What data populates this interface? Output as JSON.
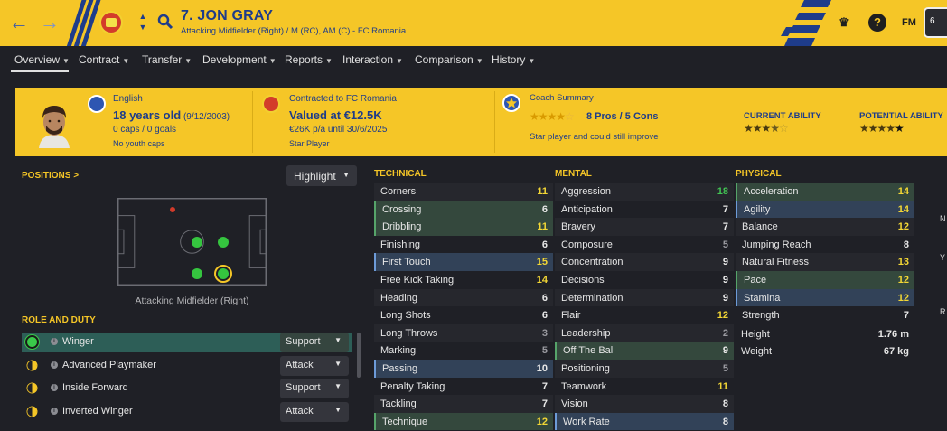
{
  "header": {
    "player_name": "7. JON GRAY",
    "player_sub": "Attacking Midfielder (Right) / M (RC), AM (C) - FC Romania",
    "fm_label": "FM",
    "help_label": "?",
    "right_box": "6"
  },
  "tabs": [
    {
      "label": "Overview"
    },
    {
      "label": "Contract"
    },
    {
      "label": "Transfer"
    },
    {
      "label": "Development"
    },
    {
      "label": "Reports"
    },
    {
      "label": "Interaction"
    },
    {
      "label": "Comparison"
    },
    {
      "label": "History"
    }
  ],
  "info": {
    "nationality": "English",
    "age": "18 years old",
    "dob": "(9/12/2003)",
    "caps": "0 caps / 0 goals",
    "youth_caps": "No youth caps",
    "contract": "Contracted to FC Romania",
    "value": "Valued at €12.5K",
    "wage": "€26K p/a until 30/6/2025",
    "status": "Star Player",
    "coach_title": "Coach Summary",
    "pros_cons": "8 Pros / 5 Cons",
    "coach_note": "Star player and could still improve",
    "coach_stars": 4.5,
    "current_ability_label": "CURRENT ABILITY",
    "current_ability_stars": 3.5,
    "potential_ability_label": "POTENTIAL ABILITY",
    "potential_ability_stars": 5
  },
  "positions": {
    "label": "POSITIONS >",
    "highlight": "Highlight",
    "pitch_caption": "Attacking Midfielder (Right)"
  },
  "roles": {
    "label": "ROLE AND DUTY",
    "items": [
      {
        "name": "Winger",
        "duty": "Support",
        "suitability": "full"
      },
      {
        "name": "Advanced Playmaker",
        "duty": "Attack",
        "suitability": "half"
      },
      {
        "name": "Inside Forward",
        "duty": "Support",
        "suitability": "half"
      },
      {
        "name": "Inverted Winger",
        "duty": "Attack",
        "suitability": "half"
      }
    ]
  },
  "technical": {
    "label": "TECHNICAL",
    "rows": [
      {
        "name": "Corners",
        "value": "11"
      },
      {
        "name": "Crossing",
        "value": "6"
      },
      {
        "name": "Dribbling",
        "value": "11"
      },
      {
        "name": "Finishing",
        "value": "6"
      },
      {
        "name": "First Touch",
        "value": "15"
      },
      {
        "name": "Free Kick Taking",
        "value": "14"
      },
      {
        "name": "Heading",
        "value": "6"
      },
      {
        "name": "Long Shots",
        "value": "6"
      },
      {
        "name": "Long Throws",
        "value": "3"
      },
      {
        "name": "Marking",
        "value": "5"
      },
      {
        "name": "Passing",
        "value": "10"
      },
      {
        "name": "Penalty Taking",
        "value": "7"
      },
      {
        "name": "Tackling",
        "value": "7"
      },
      {
        "name": "Technique",
        "value": "12"
      }
    ]
  },
  "mental": {
    "label": "MENTAL",
    "rows": [
      {
        "name": "Aggression",
        "value": "18"
      },
      {
        "name": "Anticipation",
        "value": "7"
      },
      {
        "name": "Bravery",
        "value": "7"
      },
      {
        "name": "Composure",
        "value": "5"
      },
      {
        "name": "Concentration",
        "value": "9"
      },
      {
        "name": "Decisions",
        "value": "9"
      },
      {
        "name": "Determination",
        "value": "9"
      },
      {
        "name": "Flair",
        "value": "12"
      },
      {
        "name": "Leadership",
        "value": "2"
      },
      {
        "name": "Off The Ball",
        "value": "9"
      },
      {
        "name": "Positioning",
        "value": "5"
      },
      {
        "name": "Teamwork",
        "value": "11"
      },
      {
        "name": "Vision",
        "value": "8"
      },
      {
        "name": "Work Rate",
        "value": "8"
      }
    ]
  },
  "physical": {
    "label": "PHYSICAL",
    "rows": [
      {
        "name": "Acceleration",
        "value": "14"
      },
      {
        "name": "Agility",
        "value": "14"
      },
      {
        "name": "Balance",
        "value": "12"
      },
      {
        "name": "Jumping Reach",
        "value": "8"
      },
      {
        "name": "Natural Fitness",
        "value": "13"
      },
      {
        "name": "Pace",
        "value": "12"
      },
      {
        "name": "Stamina",
        "value": "12"
      },
      {
        "name": "Strength",
        "value": "7"
      }
    ],
    "height_label": "Height",
    "height_value": "1.76 m",
    "weight_label": "Weight",
    "weight_value": "67 kg"
  },
  "edge_letters": [
    "N",
    "Y",
    "R"
  ],
  "colors": {
    "accent": "#f5c627",
    "brand_blue": "#1e3c8a",
    "value_yellow": "#f2d635",
    "value_green": "#42c454"
  }
}
